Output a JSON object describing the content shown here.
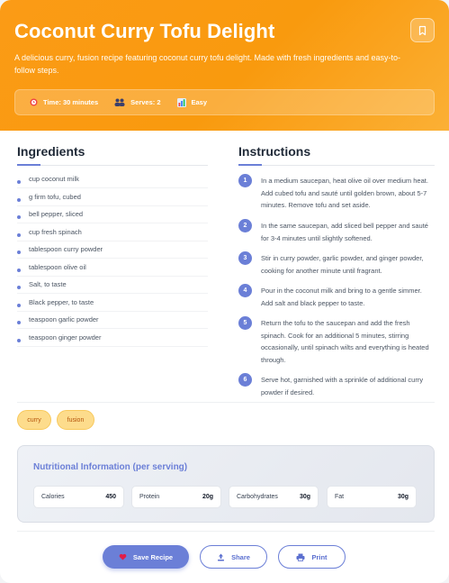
{
  "recipe": {
    "title": "Coconut Curry Tofu Delight",
    "description": "A delicious curry, fusion recipe featuring coconut curry tofu delight. Made with fresh ingredients and easy-to-follow steps.",
    "meta": {
      "time": "Time: 30 minutes",
      "serves": "Serves: 2",
      "difficulty": "Easy"
    }
  },
  "ingredients": {
    "heading": "Ingredients",
    "items": [
      "cup coconut milk",
      "g firm tofu, cubed",
      "bell pepper, sliced",
      "cup fresh spinach",
      "tablespoon curry powder",
      "tablespoon olive oil",
      "Salt, to taste",
      "Black pepper, to taste",
      "teaspoon garlic powder",
      "teaspoon ginger powder"
    ]
  },
  "instructions": {
    "heading": "Instructions",
    "steps": [
      {
        "num": "1",
        "text": "In a medium saucepan, heat olive oil over medium heat. Add cubed tofu and sauté until golden brown, about 5-7 minutes. Remove tofu and set aside."
      },
      {
        "num": "2",
        "text": "In the same saucepan, add sliced bell pepper and sauté for 3-4 minutes until slightly softened."
      },
      {
        "num": "3",
        "text": "Stir in curry powder, garlic powder, and ginger powder, cooking for another minute until fragrant."
      },
      {
        "num": "4",
        "text": "Pour in the coconut milk and bring to a gentle simmer. Add salt and black pepper to taste."
      },
      {
        "num": "5",
        "text": "Return the tofu to the saucepan and add the fresh spinach. Cook for an additional 5 minutes, stirring occasionally, until spinach wilts and everything is heated through."
      },
      {
        "num": "6",
        "text": "Serve hot, garnished with a sprinkle of additional curry powder if desired."
      }
    ]
  },
  "tags": [
    "curry",
    "fusion"
  ],
  "nutrition": {
    "title": "Nutritional Information (per serving)",
    "items": [
      {
        "label": "Calories",
        "value": "450"
      },
      {
        "label": "Protein",
        "value": "20g"
      },
      {
        "label": "Carbohydrates",
        "value": "30g"
      },
      {
        "label": "Fat",
        "value": "30g"
      }
    ]
  },
  "actions": {
    "save": "Save Recipe",
    "share": "Share",
    "print": "Print"
  },
  "colors": {
    "header": "#fb9b16",
    "accent": "#6b7fd7",
    "tag_bg": "#fddc8c",
    "tag_text": "#b45309"
  },
  "icons": {
    "bookmark": "bookmark-icon",
    "time": "clock-icon",
    "serves": "people-icon",
    "difficulty": "bar-chart-icon",
    "save": "heart-icon",
    "share": "share-icon",
    "print": "printer-icon"
  }
}
